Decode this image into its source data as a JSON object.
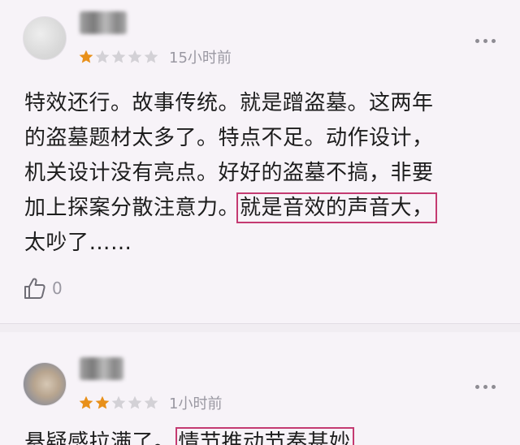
{
  "reviews": [
    {
      "username": "用户",
      "rating": 1,
      "max_rating": 5,
      "time": "15小时前",
      "comment_lines": [
        "特效还行。故事传统。就是蹭盗墓。这两年",
        "的盗墓题材太多了。特点不足。动作设计，",
        "机关设计没有亮点。好好的盗墓不搞，非要",
        "加上探案分散注意力。",
        "就是音效的声音大，",
        "太吵了……"
      ],
      "likes": "0"
    },
    {
      "username": "用户",
      "rating": 2,
      "max_rating": 5,
      "time": "1小时前",
      "comment_lines": [
        "悬疑感拉满了。",
        "情节推动节奏甚妙"
      ]
    }
  ],
  "colors": {
    "star_filled": "#e8901a",
    "star_empty": "#d3d1d6",
    "highlight_border": "#c43a71"
  },
  "icons": {
    "more": "more-dots-icon",
    "like": "thumbs-up-icon",
    "star": "star-icon"
  }
}
